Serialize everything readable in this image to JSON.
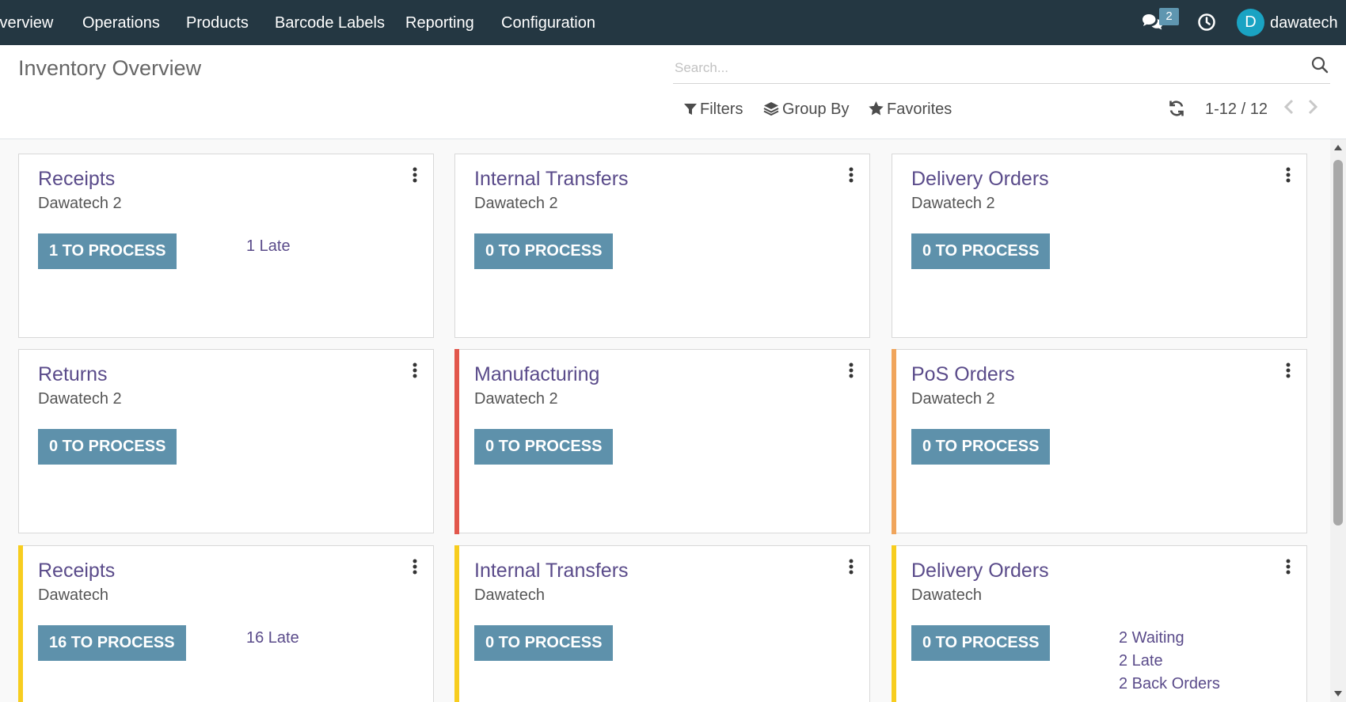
{
  "navbar": {
    "items": [
      "Overview",
      "Operations",
      "Products",
      "Barcode Labels",
      "Reporting",
      "Configuration"
    ],
    "messages_badge": "2",
    "avatar_letter": "D",
    "username": "dawatech",
    "colors": {
      "background": "#243742",
      "avatar": "#1aa3c3",
      "badge": "#5f96b0"
    }
  },
  "control_panel": {
    "title": "Inventory Overview",
    "search_placeholder": "Search...",
    "filters_label": "Filters",
    "group_by_label": "Group By",
    "favorites_label": "Favorites",
    "pager_value": "1-12 / 12"
  },
  "cards": [
    {
      "title": "Receipts",
      "subtitle": "Dawatech 2",
      "button": "1 TO PROCESS",
      "stripe_color": "",
      "links": [
        "1 Late"
      ]
    },
    {
      "title": "Internal Transfers",
      "subtitle": "Dawatech 2",
      "button": "0 TO PROCESS",
      "stripe_color": "",
      "links": []
    },
    {
      "title": "Delivery Orders",
      "subtitle": "Dawatech 2",
      "button": "0 TO PROCESS",
      "stripe_color": "",
      "links": []
    },
    {
      "title": "Returns",
      "subtitle": "Dawatech 2",
      "button": "0 TO PROCESS",
      "stripe_color": "",
      "links": []
    },
    {
      "title": "Manufacturing",
      "subtitle": "Dawatech 2",
      "button": "0 TO PROCESS",
      "stripe_color": "#e2574c",
      "links": []
    },
    {
      "title": "PoS Orders",
      "subtitle": "Dawatech 2",
      "button": "0 TO PROCESS",
      "stripe_color": "#f0a55c",
      "links": []
    },
    {
      "title": "Receipts",
      "subtitle": "Dawatech",
      "button": "16 TO PROCESS",
      "stripe_color": "#f7cd1f",
      "links": [
        "16 Late"
      ]
    },
    {
      "title": "Internal Transfers",
      "subtitle": "Dawatech",
      "button": "0 TO PROCESS",
      "stripe_color": "#f7cd1f",
      "links": []
    },
    {
      "title": "Delivery Orders",
      "subtitle": "Dawatech",
      "button": "0 TO PROCESS",
      "stripe_color": "#f7cd1f",
      "links": [
        "2 Waiting",
        "2 Late",
        "2 Back Orders"
      ]
    }
  ],
  "colors": {
    "button": "#5e91ab",
    "title": "#5a4b8a"
  }
}
